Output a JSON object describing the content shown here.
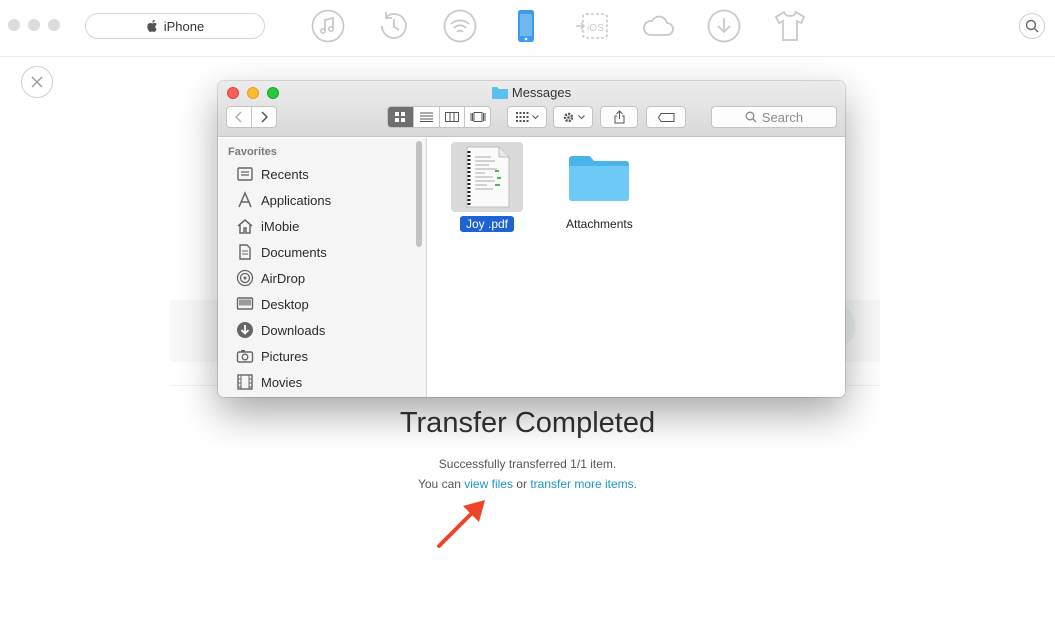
{
  "topbar": {
    "device_label": "iPhone",
    "tools": [
      "music-icon",
      "history-icon",
      "wifi-sync-icon",
      "phone-icon",
      "ios-transfer-icon",
      "cloud-icon",
      "download-icon",
      "shirt-icon"
    ],
    "active_tool": "phone-icon",
    "accent": "#3d9be9"
  },
  "finder": {
    "title": "Messages",
    "search_placeholder": "Search",
    "sidebar_heading": "Favorites",
    "sidebar_items": [
      {
        "label": "Recents",
        "icon": "recents-icon"
      },
      {
        "label": "Applications",
        "icon": "applications-icon"
      },
      {
        "label": "iMobie",
        "icon": "home-icon"
      },
      {
        "label": "Documents",
        "icon": "documents-icon"
      },
      {
        "label": "AirDrop",
        "icon": "airdrop-icon"
      },
      {
        "label": "Desktop",
        "icon": "desktop-icon"
      },
      {
        "label": "Downloads",
        "icon": "downloads-icon"
      },
      {
        "label": "Pictures",
        "icon": "pictures-icon"
      },
      {
        "label": "Movies",
        "icon": "movies-icon"
      }
    ],
    "files": [
      {
        "name": "Joy .pdf",
        "type": "pdf",
        "selected": true
      },
      {
        "name": "Attachments",
        "type": "folder",
        "selected": false
      }
    ]
  },
  "transfer": {
    "title": "Transfer Completed",
    "subtitle": "Successfully transferred 1/1 item.",
    "prefix": "You can",
    "view_files_link": "view files",
    "or_text": "or",
    "more_link": "transfer more items."
  },
  "colors": {
    "link": "#1a95c9",
    "arrow": "#f0442a",
    "selection": "#1e63d6",
    "folder": "#5bc0f0"
  }
}
